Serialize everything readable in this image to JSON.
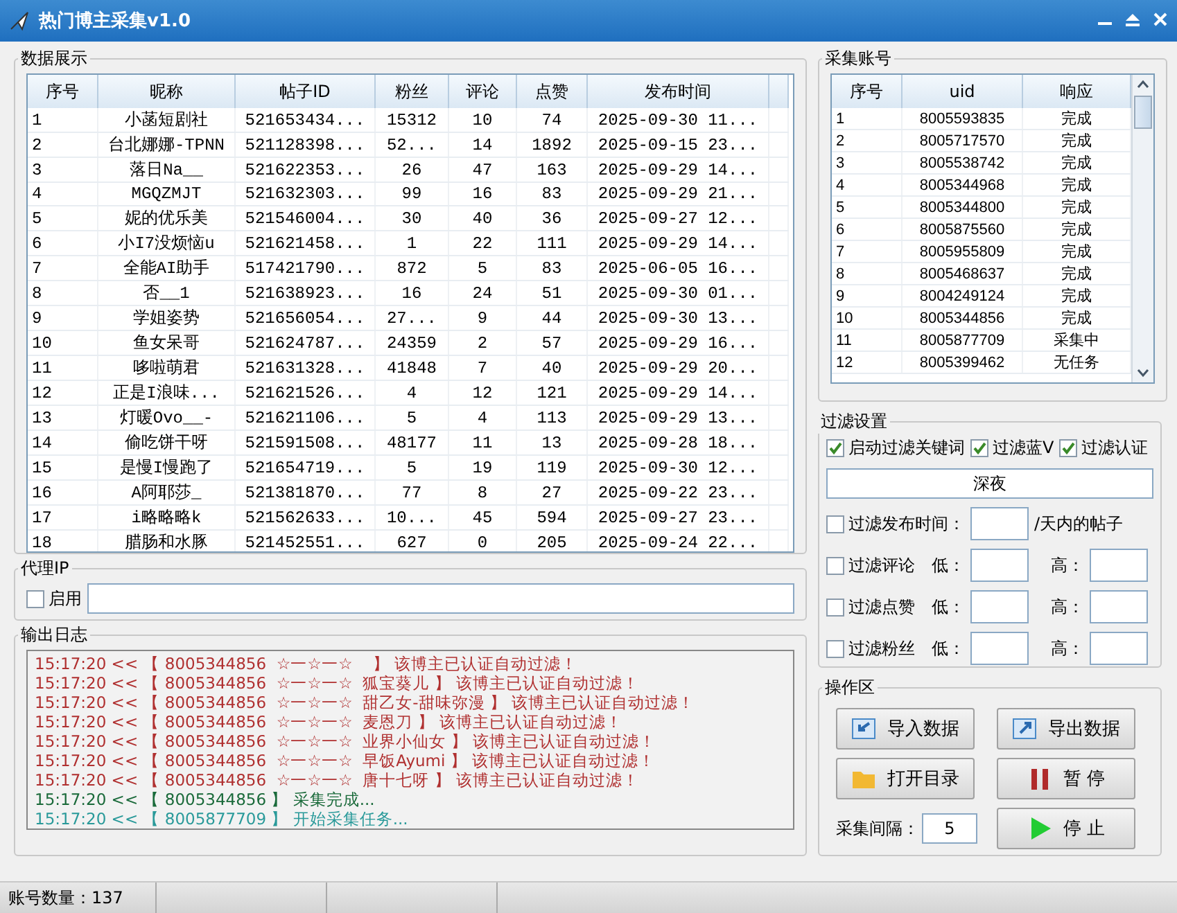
{
  "window": {
    "title": "热门博主采集v1.0"
  },
  "data_panel": {
    "title": "数据展示",
    "columns": [
      "序号",
      "昵称",
      "帖子ID",
      "粉丝",
      "评论",
      "点赞",
      "发布时间"
    ],
    "rows": [
      [
        "1",
        "小菡短剧社",
        "521653434...",
        "15312",
        "10",
        "74",
        "2025-09-30 11..."
      ],
      [
        "2",
        "台北娜娜-TPNN",
        "521128398...",
        "52...",
        "14",
        "1892",
        "2025-09-15 23..."
      ],
      [
        "3",
        "落日Na__",
        "521622353...",
        "26",
        "47",
        "163",
        "2025-09-29 14..."
      ],
      [
        "4",
        "MGQZMJT",
        "521632303...",
        "99",
        "16",
        "83",
        "2025-09-29 21..."
      ],
      [
        "5",
        "妮的优乐美",
        "521546004...",
        "30",
        "40",
        "36",
        "2025-09-27 12..."
      ],
      [
        "6",
        "小I7没烦恼u",
        "521621458...",
        "1",
        "22",
        "111",
        "2025-09-29 14..."
      ],
      [
        "7",
        "全能AI助手",
        "517421790...",
        "872",
        "5",
        "83",
        "2025-06-05 16..."
      ],
      [
        "8",
        "否__1",
        "521638923...",
        "16",
        "24",
        "51",
        "2025-09-30 01..."
      ],
      [
        "9",
        "学姐姿势",
        "521656054...",
        "27...",
        "9",
        "44",
        "2025-09-30 13..."
      ],
      [
        "10",
        "鱼女呆哥",
        "521624787...",
        "24359",
        "2",
        "57",
        "2025-09-29 16..."
      ],
      [
        "11",
        "哆啦萌君",
        "521631328...",
        "41848",
        "7",
        "40",
        "2025-09-29 20..."
      ],
      [
        "12",
        "正是I浪味...",
        "521621526...",
        "4",
        "12",
        "121",
        "2025-09-29 14..."
      ],
      [
        "13",
        "灯暖Ovo__-",
        "521621106...",
        "5",
        "4",
        "113",
        "2025-09-29 13..."
      ],
      [
        "14",
        "偷吃饼干呀",
        "521591508...",
        "48177",
        "11",
        "13",
        "2025-09-28 18..."
      ],
      [
        "15",
        "是慢I慢跑了",
        "521654719...",
        "5",
        "19",
        "119",
        "2025-09-30 12..."
      ],
      [
        "16",
        "A阿耶莎_",
        "521381870...",
        "77",
        "8",
        "27",
        "2025-09-22 23..."
      ],
      [
        "17",
        "i略略略k",
        "521562633...",
        "10...",
        "45",
        "594",
        "2025-09-27 23..."
      ],
      [
        "18",
        "腊肠和水豚",
        "521452551...",
        "627",
        "0",
        "205",
        "2025-09-24 22..."
      ]
    ]
  },
  "proxy": {
    "title": "代理IP",
    "enable": {
      "label": "启用",
      "checked": false
    }
  },
  "log": {
    "title": "输出日志",
    "lines": [
      {
        "kind": "filtered",
        "text": "15:17:20 << 【 8005344856  ☆一☆一☆    】 该博主已认证自动过滤！"
      },
      {
        "kind": "filtered",
        "text": "15:17:20 << 【 8005344856  ☆一☆一☆  狐宝葵儿 】 该博主已认证自动过滤！"
      },
      {
        "kind": "filtered",
        "text": "15:17:20 << 【 8005344856  ☆一☆一☆  甜乙女-甜味弥漫 】 该博主已认证自动过滤！"
      },
      {
        "kind": "filtered",
        "text": "15:17:20 << 【 8005344856  ☆一☆一☆  麦恩刀 】 该博主已认证自动过滤！"
      },
      {
        "kind": "filtered",
        "text": "15:17:20 << 【 8005344856  ☆一☆一☆  业界小仙女 】 该博主已认证自动过滤！"
      },
      {
        "kind": "filtered",
        "text": "15:17:20 << 【 8005344856  ☆一☆一☆  早饭Ayumi 】 该博主已认证自动过滤！"
      },
      {
        "kind": "filtered",
        "text": "15:17:20 << 【 8005344856  ☆一☆一☆  唐十七呀 】 该博主已认证自动过滤！"
      },
      {
        "kind": "done",
        "text": "15:17:20 << 【 8005344856 】 采集完成..."
      },
      {
        "kind": "start",
        "text": "15:17:20 << 【 8005877709 】 开始采集任务..."
      }
    ]
  },
  "accounts": {
    "title": "采集账号",
    "columns": [
      "序号",
      "uid",
      "响应"
    ],
    "rows": [
      [
        "1",
        "8005593835",
        "完成"
      ],
      [
        "2",
        "8005717570",
        "完成"
      ],
      [
        "3",
        "8005538742",
        "完成"
      ],
      [
        "4",
        "8005344968",
        "完成"
      ],
      [
        "5",
        "8005344800",
        "完成"
      ],
      [
        "6",
        "8005875560",
        "完成"
      ],
      [
        "7",
        "8005955809",
        "完成"
      ],
      [
        "8",
        "8005468637",
        "完成"
      ],
      [
        "9",
        "8004249124",
        "完成"
      ],
      [
        "10",
        "8005344856",
        "完成"
      ],
      [
        "11",
        "8005877709",
        "采集中"
      ],
      [
        "12",
        "8005399462",
        "无任务"
      ]
    ]
  },
  "filters": {
    "title": "过滤设置",
    "options": [
      {
        "label": "启动过滤关键词",
        "checked": true
      },
      {
        "label": "过滤蓝V",
        "checked": true
      },
      {
        "label": "过滤认证",
        "checked": true
      }
    ],
    "keyword": "深夜",
    "time": {
      "label": "过滤发布时间：",
      "checked": false,
      "suffix": "/天内的帖子"
    },
    "ranges": [
      {
        "label": "过滤评论",
        "checked": false,
        "low": "低：",
        "high": "高："
      },
      {
        "label": "过滤点赞",
        "checked": false,
        "low": "低：",
        "high": "高："
      },
      {
        "label": "过滤粉丝",
        "checked": false,
        "low": "低：",
        "high": "高："
      }
    ]
  },
  "operations": {
    "title": "操作区",
    "buttons": [
      {
        "label": "导入数据",
        "kind": "import"
      },
      {
        "label": "导出数据",
        "kind": "export"
      },
      {
        "label": "打开目录",
        "kind": "folder"
      },
      {
        "label": "暂 停",
        "kind": "pause"
      },
      {
        "label": "停 止",
        "kind": "stop"
      }
    ],
    "interval": {
      "label": "采集间隔：",
      "value": "5"
    }
  },
  "status_bar": {
    "text": "账号数量：137"
  }
}
